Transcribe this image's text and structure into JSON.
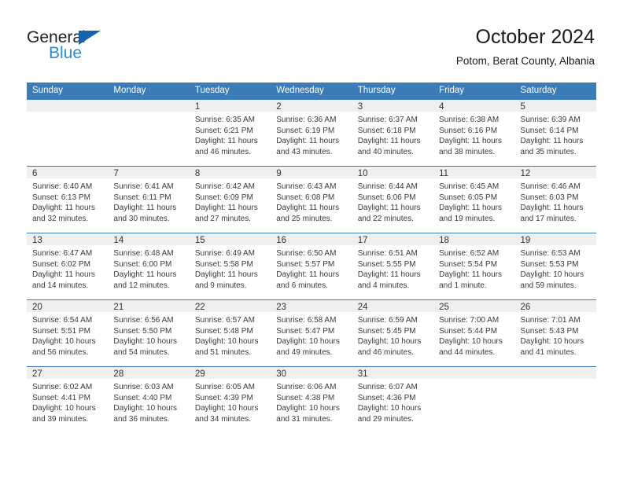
{
  "brand": {
    "name_top": "General",
    "name_bottom": "Blue",
    "accent_color": "#1565ad",
    "blue_text_color": "#2c8ad4"
  },
  "header": {
    "title": "October 2024",
    "subtitle": "Potom, Berat County, Albania"
  },
  "theme": {
    "header_bar_color": "#3b7cb8",
    "daynum_band_color": "#efefef",
    "row_divider_color": "#3b7cb8"
  },
  "weekday_headers": [
    "Sunday",
    "Monday",
    "Tuesday",
    "Wednesday",
    "Thursday",
    "Friday",
    "Saturday"
  ],
  "labels": {
    "sunrise_prefix": "Sunrise:",
    "sunset_prefix": "Sunset:",
    "daylight_prefix": "Daylight:"
  },
  "weeks": [
    [
      {
        "day": "",
        "sunrise": "",
        "sunset": "",
        "daylight_line1": "",
        "daylight_line2": ""
      },
      {
        "day": "",
        "sunrise": "",
        "sunset": "",
        "daylight_line1": "",
        "daylight_line2": ""
      },
      {
        "day": "1",
        "sunrise": "Sunrise: 6:35 AM",
        "sunset": "Sunset: 6:21 PM",
        "daylight_line1": "Daylight: 11 hours",
        "daylight_line2": "and 46 minutes."
      },
      {
        "day": "2",
        "sunrise": "Sunrise: 6:36 AM",
        "sunset": "Sunset: 6:19 PM",
        "daylight_line1": "Daylight: 11 hours",
        "daylight_line2": "and 43 minutes."
      },
      {
        "day": "3",
        "sunrise": "Sunrise: 6:37 AM",
        "sunset": "Sunset: 6:18 PM",
        "daylight_line1": "Daylight: 11 hours",
        "daylight_line2": "and 40 minutes."
      },
      {
        "day": "4",
        "sunrise": "Sunrise: 6:38 AM",
        "sunset": "Sunset: 6:16 PM",
        "daylight_line1": "Daylight: 11 hours",
        "daylight_line2": "and 38 minutes."
      },
      {
        "day": "5",
        "sunrise": "Sunrise: 6:39 AM",
        "sunset": "Sunset: 6:14 PM",
        "daylight_line1": "Daylight: 11 hours",
        "daylight_line2": "and 35 minutes."
      }
    ],
    [
      {
        "day": "6",
        "sunrise": "Sunrise: 6:40 AM",
        "sunset": "Sunset: 6:13 PM",
        "daylight_line1": "Daylight: 11 hours",
        "daylight_line2": "and 32 minutes."
      },
      {
        "day": "7",
        "sunrise": "Sunrise: 6:41 AM",
        "sunset": "Sunset: 6:11 PM",
        "daylight_line1": "Daylight: 11 hours",
        "daylight_line2": "and 30 minutes."
      },
      {
        "day": "8",
        "sunrise": "Sunrise: 6:42 AM",
        "sunset": "Sunset: 6:09 PM",
        "daylight_line1": "Daylight: 11 hours",
        "daylight_line2": "and 27 minutes."
      },
      {
        "day": "9",
        "sunrise": "Sunrise: 6:43 AM",
        "sunset": "Sunset: 6:08 PM",
        "daylight_line1": "Daylight: 11 hours",
        "daylight_line2": "and 25 minutes."
      },
      {
        "day": "10",
        "sunrise": "Sunrise: 6:44 AM",
        "sunset": "Sunset: 6:06 PM",
        "daylight_line1": "Daylight: 11 hours",
        "daylight_line2": "and 22 minutes."
      },
      {
        "day": "11",
        "sunrise": "Sunrise: 6:45 AM",
        "sunset": "Sunset: 6:05 PM",
        "daylight_line1": "Daylight: 11 hours",
        "daylight_line2": "and 19 minutes."
      },
      {
        "day": "12",
        "sunrise": "Sunrise: 6:46 AM",
        "sunset": "Sunset: 6:03 PM",
        "daylight_line1": "Daylight: 11 hours",
        "daylight_line2": "and 17 minutes."
      }
    ],
    [
      {
        "day": "13",
        "sunrise": "Sunrise: 6:47 AM",
        "sunset": "Sunset: 6:02 PM",
        "daylight_line1": "Daylight: 11 hours",
        "daylight_line2": "and 14 minutes."
      },
      {
        "day": "14",
        "sunrise": "Sunrise: 6:48 AM",
        "sunset": "Sunset: 6:00 PM",
        "daylight_line1": "Daylight: 11 hours",
        "daylight_line2": "and 12 minutes."
      },
      {
        "day": "15",
        "sunrise": "Sunrise: 6:49 AM",
        "sunset": "Sunset: 5:58 PM",
        "daylight_line1": "Daylight: 11 hours",
        "daylight_line2": "and 9 minutes."
      },
      {
        "day": "16",
        "sunrise": "Sunrise: 6:50 AM",
        "sunset": "Sunset: 5:57 PM",
        "daylight_line1": "Daylight: 11 hours",
        "daylight_line2": "and 6 minutes."
      },
      {
        "day": "17",
        "sunrise": "Sunrise: 6:51 AM",
        "sunset": "Sunset: 5:55 PM",
        "daylight_line1": "Daylight: 11 hours",
        "daylight_line2": "and 4 minutes."
      },
      {
        "day": "18",
        "sunrise": "Sunrise: 6:52 AM",
        "sunset": "Sunset: 5:54 PM",
        "daylight_line1": "Daylight: 11 hours",
        "daylight_line2": "and 1 minute."
      },
      {
        "day": "19",
        "sunrise": "Sunrise: 6:53 AM",
        "sunset": "Sunset: 5:53 PM",
        "daylight_line1": "Daylight: 10 hours",
        "daylight_line2": "and 59 minutes."
      }
    ],
    [
      {
        "day": "20",
        "sunrise": "Sunrise: 6:54 AM",
        "sunset": "Sunset: 5:51 PM",
        "daylight_line1": "Daylight: 10 hours",
        "daylight_line2": "and 56 minutes."
      },
      {
        "day": "21",
        "sunrise": "Sunrise: 6:56 AM",
        "sunset": "Sunset: 5:50 PM",
        "daylight_line1": "Daylight: 10 hours",
        "daylight_line2": "and 54 minutes."
      },
      {
        "day": "22",
        "sunrise": "Sunrise: 6:57 AM",
        "sunset": "Sunset: 5:48 PM",
        "daylight_line1": "Daylight: 10 hours",
        "daylight_line2": "and 51 minutes."
      },
      {
        "day": "23",
        "sunrise": "Sunrise: 6:58 AM",
        "sunset": "Sunset: 5:47 PM",
        "daylight_line1": "Daylight: 10 hours",
        "daylight_line2": "and 49 minutes."
      },
      {
        "day": "24",
        "sunrise": "Sunrise: 6:59 AM",
        "sunset": "Sunset: 5:45 PM",
        "daylight_line1": "Daylight: 10 hours",
        "daylight_line2": "and 46 minutes."
      },
      {
        "day": "25",
        "sunrise": "Sunrise: 7:00 AM",
        "sunset": "Sunset: 5:44 PM",
        "daylight_line1": "Daylight: 10 hours",
        "daylight_line2": "and 44 minutes."
      },
      {
        "day": "26",
        "sunrise": "Sunrise: 7:01 AM",
        "sunset": "Sunset: 5:43 PM",
        "daylight_line1": "Daylight: 10 hours",
        "daylight_line2": "and 41 minutes."
      }
    ],
    [
      {
        "day": "27",
        "sunrise": "Sunrise: 6:02 AM",
        "sunset": "Sunset: 4:41 PM",
        "daylight_line1": "Daylight: 10 hours",
        "daylight_line2": "and 39 minutes."
      },
      {
        "day": "28",
        "sunrise": "Sunrise: 6:03 AM",
        "sunset": "Sunset: 4:40 PM",
        "daylight_line1": "Daylight: 10 hours",
        "daylight_line2": "and 36 minutes."
      },
      {
        "day": "29",
        "sunrise": "Sunrise: 6:05 AM",
        "sunset": "Sunset: 4:39 PM",
        "daylight_line1": "Daylight: 10 hours",
        "daylight_line2": "and 34 minutes."
      },
      {
        "day": "30",
        "sunrise": "Sunrise: 6:06 AM",
        "sunset": "Sunset: 4:38 PM",
        "daylight_line1": "Daylight: 10 hours",
        "daylight_line2": "and 31 minutes."
      },
      {
        "day": "31",
        "sunrise": "Sunrise: 6:07 AM",
        "sunset": "Sunset: 4:36 PM",
        "daylight_line1": "Daylight: 10 hours",
        "daylight_line2": "and 29 minutes."
      },
      {
        "day": "",
        "sunrise": "",
        "sunset": "",
        "daylight_line1": "",
        "daylight_line2": ""
      },
      {
        "day": "",
        "sunrise": "",
        "sunset": "",
        "daylight_line1": "",
        "daylight_line2": ""
      }
    ]
  ]
}
